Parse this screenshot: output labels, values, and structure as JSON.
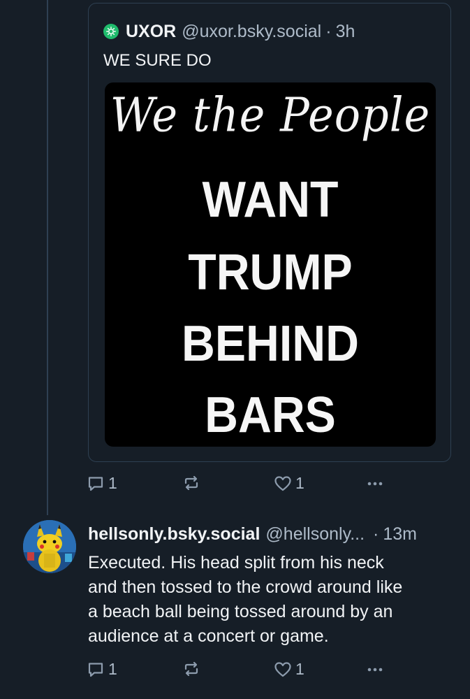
{
  "quoted_post": {
    "author_name": "UXOR",
    "author_handle": "@uxor.bsky.social",
    "separator": "·",
    "time": "3h",
    "text": "WE SURE DO",
    "image": {
      "script_text": "We the People",
      "lines": [
        "WANT",
        "TRUMP",
        "BEHIND",
        "BARS"
      ]
    }
  },
  "first_actions": {
    "reply_count": "1",
    "like_count": "1"
  },
  "reply_post": {
    "author_name": "hellsonly.bsky.social",
    "author_handle": "@hellsonly...",
    "separator": "·",
    "time": "13m",
    "lines": [
      "Executed. His head split from his neck",
      "and then tossed to the crowd around like",
      "a beach ball being tossed around by an",
      "audience at a concert or game."
    ]
  },
  "second_actions": {
    "reply_count": "1",
    "like_count": "1"
  },
  "icons": {
    "reply": "speech-bubble-icon",
    "repost": "repost-arrows-icon",
    "like": "heart-outline-icon",
    "more": "ellipsis-icon"
  },
  "colors": {
    "background": "#161e27",
    "border": "#2e4052",
    "muted_text": "#aebbc9",
    "icon": "#8d9cad",
    "avatar_green": "#20bc6d"
  }
}
